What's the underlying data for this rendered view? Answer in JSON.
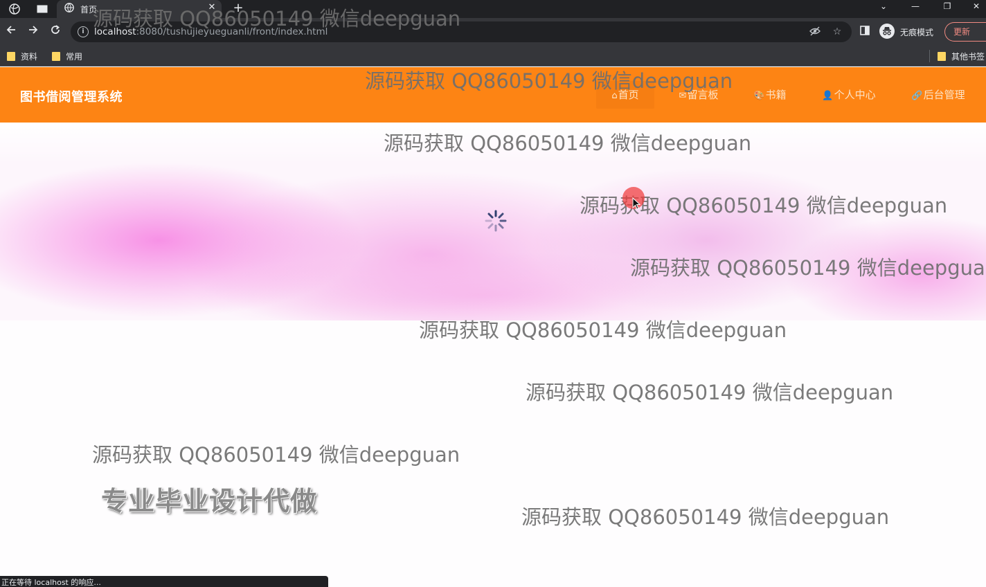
{
  "browser": {
    "tab": {
      "title": "首页"
    },
    "address_bar": {
      "host": "localhost",
      "path": ":8080/tushujieyueguanli/front/index.html"
    },
    "profile": {
      "incognito_label": "无痕模式",
      "update_label": "更新"
    },
    "bookmarks": [
      {
        "label": "资料"
      },
      {
        "label": "常用"
      }
    ],
    "other_bookmarks": "其他书签",
    "status_text": "正在等待 localhost 的响应..."
  },
  "site": {
    "title": "图书借阅管理系统",
    "accent_color": "#fd8414",
    "menu": [
      {
        "label": "首页",
        "icon": "home-icon",
        "active": true
      },
      {
        "label": "留言板",
        "icon": "mail-icon",
        "active": false
      },
      {
        "label": "书籍",
        "icon": "palette-icon",
        "active": false
      },
      {
        "label": "个人中心",
        "icon": "user-icon",
        "active": false
      },
      {
        "label": "后台管理",
        "icon": "link-icon",
        "active": false
      }
    ]
  },
  "promo_text": "专业毕业设计代做",
  "watermark_text": "源码获取 QQ86050149 微信deepguan"
}
